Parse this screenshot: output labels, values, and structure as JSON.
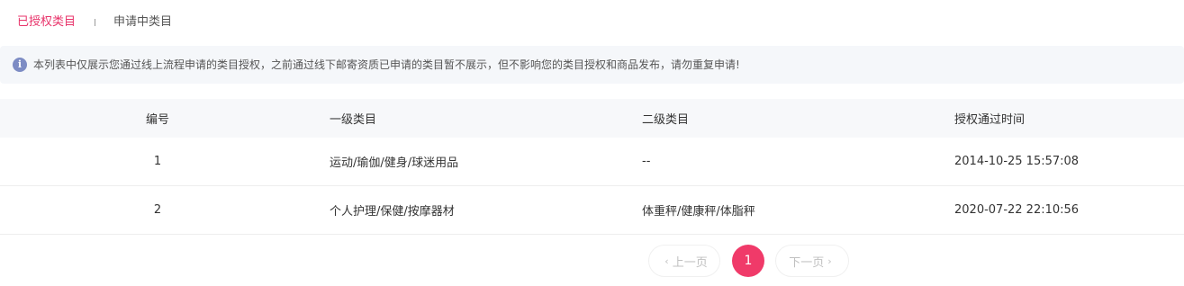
{
  "tabs": {
    "active_label": "已授权类目",
    "inactive_label": "申请中类目"
  },
  "notice": {
    "icon": "info-icon",
    "icon_glyph": "i",
    "text": "本列表中仅展示您通过线上流程申请的类目授权，之前通过线下邮寄资质已申请的类目暂不展示，但不影响您的类目授权和商品发布，请勿重复申请!"
  },
  "table": {
    "headers": {
      "id": "编号",
      "level1": "一级类目",
      "level2": "二级类目",
      "time": "授权通过时间"
    },
    "rows": [
      {
        "id": "1",
        "level1": "运动/瑜伽/健身/球迷用品",
        "level2": "--",
        "time": "2014-10-25 15:57:08"
      },
      {
        "id": "2",
        "level1": "个人护理/保健/按摩器材",
        "level2": "体重秤/健康秤/体脂秤",
        "time": "2020-07-22 22:10:56"
      }
    ]
  },
  "pagination": {
    "prev_label": "上一页",
    "next_label": "下一页",
    "current_page": "1",
    "prev_icon": "chevron-left-icon",
    "next_icon": "chevron-right-icon"
  },
  "colors": {
    "accent": "#f03a69",
    "active_tab": "#e8336a",
    "info_icon": "#7d8cc4"
  }
}
